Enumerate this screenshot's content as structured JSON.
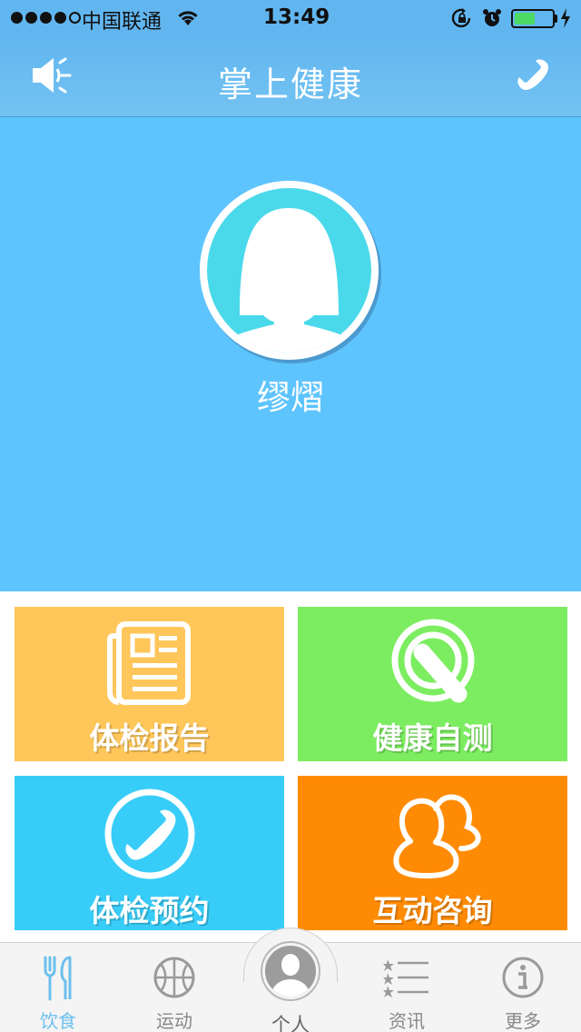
{
  "status_bar": {
    "carrier": "中国联通",
    "time": "13:49",
    "battery_level": 0.55,
    "signal_bars": 4
  },
  "nav": {
    "title": "掌上健康",
    "left_icon": "speaker-icon",
    "right_icon": "phone-icon"
  },
  "profile": {
    "name": "缪熠"
  },
  "tiles": [
    {
      "label": "体检报告",
      "icon": "newspaper-icon",
      "color": "#ffc65a"
    },
    {
      "label": "健康自测",
      "icon": "self-test-icon",
      "color": "#7ced60"
    },
    {
      "label": "体检预约",
      "icon": "phone-circle-icon",
      "color": "#38cdf8"
    },
    {
      "label": "互动咨询",
      "icon": "users-icon",
      "color": "#ff8b04"
    }
  ],
  "tab_bar": {
    "items": [
      {
        "label": "饮食",
        "icon": "fork-knife-icon",
        "active": true
      },
      {
        "label": "运动",
        "icon": "basketball-icon",
        "active": false
      },
      {
        "label": "个人",
        "icon": "person-icon",
        "active": false
      },
      {
        "label": "资讯",
        "icon": "list-icon",
        "active": false
      },
      {
        "label": "更多",
        "icon": "info-icon",
        "active": false
      }
    ]
  },
  "colors": {
    "nav": "#62b6f0",
    "profile_bg": "#5ec4fd",
    "accent": "#6cc0ee"
  }
}
